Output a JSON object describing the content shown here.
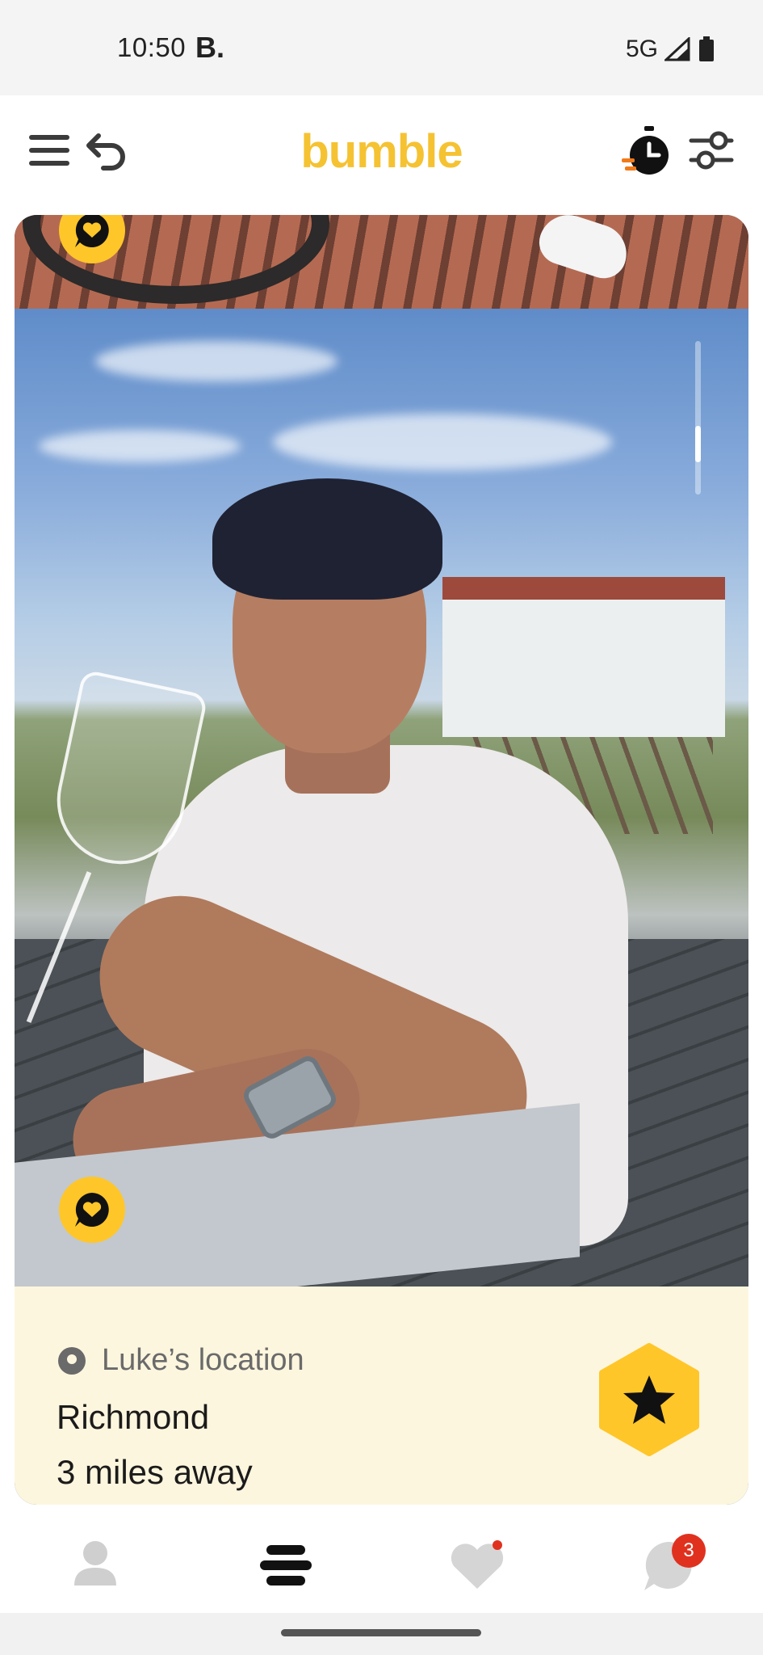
{
  "status_bar": {
    "time": "10:50",
    "carrier_badge": "B.",
    "network": "5G"
  },
  "header": {
    "brand": "bumble",
    "brand_color": "#F5C232",
    "icons": [
      "menu-icon",
      "undo-icon",
      "timer-icon",
      "filters-icon"
    ]
  },
  "profile": {
    "location_label": "Luke’s location",
    "city": "Richmond",
    "distance": "3 miles away"
  },
  "colors": {
    "accent_yellow": "#FFC629",
    "panel_bg": "#FDF6DE",
    "badge_red": "#E0311F"
  },
  "bottom_nav": {
    "items": [
      "profile-tab",
      "discover-tab",
      "likes-tab",
      "chats-tab"
    ],
    "chats_badge": "3"
  }
}
